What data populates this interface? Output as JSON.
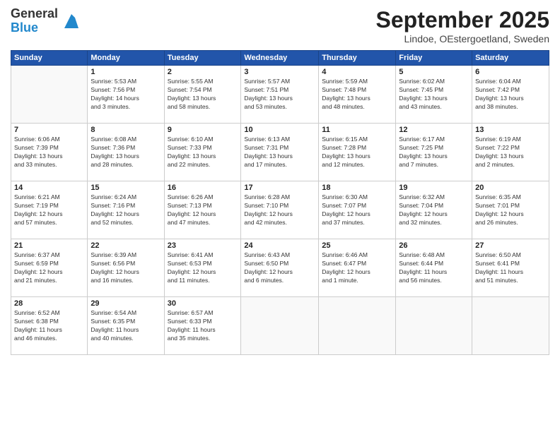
{
  "header": {
    "logo_line1": "General",
    "logo_line2": "Blue",
    "title": "September 2025",
    "location": "Lindoe, OEstergoetland, Sweden"
  },
  "days_of_week": [
    "Sunday",
    "Monday",
    "Tuesday",
    "Wednesday",
    "Thursday",
    "Friday",
    "Saturday"
  ],
  "weeks": [
    [
      {
        "day": "",
        "info": ""
      },
      {
        "day": "1",
        "info": "Sunrise: 5:53 AM\nSunset: 7:56 PM\nDaylight: 14 hours\nand 3 minutes."
      },
      {
        "day": "2",
        "info": "Sunrise: 5:55 AM\nSunset: 7:54 PM\nDaylight: 13 hours\nand 58 minutes."
      },
      {
        "day": "3",
        "info": "Sunrise: 5:57 AM\nSunset: 7:51 PM\nDaylight: 13 hours\nand 53 minutes."
      },
      {
        "day": "4",
        "info": "Sunrise: 5:59 AM\nSunset: 7:48 PM\nDaylight: 13 hours\nand 48 minutes."
      },
      {
        "day": "5",
        "info": "Sunrise: 6:02 AM\nSunset: 7:45 PM\nDaylight: 13 hours\nand 43 minutes."
      },
      {
        "day": "6",
        "info": "Sunrise: 6:04 AM\nSunset: 7:42 PM\nDaylight: 13 hours\nand 38 minutes."
      }
    ],
    [
      {
        "day": "7",
        "info": "Sunrise: 6:06 AM\nSunset: 7:39 PM\nDaylight: 13 hours\nand 33 minutes."
      },
      {
        "day": "8",
        "info": "Sunrise: 6:08 AM\nSunset: 7:36 PM\nDaylight: 13 hours\nand 28 minutes."
      },
      {
        "day": "9",
        "info": "Sunrise: 6:10 AM\nSunset: 7:33 PM\nDaylight: 13 hours\nand 22 minutes."
      },
      {
        "day": "10",
        "info": "Sunrise: 6:13 AM\nSunset: 7:31 PM\nDaylight: 13 hours\nand 17 minutes."
      },
      {
        "day": "11",
        "info": "Sunrise: 6:15 AM\nSunset: 7:28 PM\nDaylight: 13 hours\nand 12 minutes."
      },
      {
        "day": "12",
        "info": "Sunrise: 6:17 AM\nSunset: 7:25 PM\nDaylight: 13 hours\nand 7 minutes."
      },
      {
        "day": "13",
        "info": "Sunrise: 6:19 AM\nSunset: 7:22 PM\nDaylight: 13 hours\nand 2 minutes."
      }
    ],
    [
      {
        "day": "14",
        "info": "Sunrise: 6:21 AM\nSunset: 7:19 PM\nDaylight: 12 hours\nand 57 minutes."
      },
      {
        "day": "15",
        "info": "Sunrise: 6:24 AM\nSunset: 7:16 PM\nDaylight: 12 hours\nand 52 minutes."
      },
      {
        "day": "16",
        "info": "Sunrise: 6:26 AM\nSunset: 7:13 PM\nDaylight: 12 hours\nand 47 minutes."
      },
      {
        "day": "17",
        "info": "Sunrise: 6:28 AM\nSunset: 7:10 PM\nDaylight: 12 hours\nand 42 minutes."
      },
      {
        "day": "18",
        "info": "Sunrise: 6:30 AM\nSunset: 7:07 PM\nDaylight: 12 hours\nand 37 minutes."
      },
      {
        "day": "19",
        "info": "Sunrise: 6:32 AM\nSunset: 7:04 PM\nDaylight: 12 hours\nand 32 minutes."
      },
      {
        "day": "20",
        "info": "Sunrise: 6:35 AM\nSunset: 7:01 PM\nDaylight: 12 hours\nand 26 minutes."
      }
    ],
    [
      {
        "day": "21",
        "info": "Sunrise: 6:37 AM\nSunset: 6:59 PM\nDaylight: 12 hours\nand 21 minutes."
      },
      {
        "day": "22",
        "info": "Sunrise: 6:39 AM\nSunset: 6:56 PM\nDaylight: 12 hours\nand 16 minutes."
      },
      {
        "day": "23",
        "info": "Sunrise: 6:41 AM\nSunset: 6:53 PM\nDaylight: 12 hours\nand 11 minutes."
      },
      {
        "day": "24",
        "info": "Sunrise: 6:43 AM\nSunset: 6:50 PM\nDaylight: 12 hours\nand 6 minutes."
      },
      {
        "day": "25",
        "info": "Sunrise: 6:46 AM\nSunset: 6:47 PM\nDaylight: 12 hours\nand 1 minute."
      },
      {
        "day": "26",
        "info": "Sunrise: 6:48 AM\nSunset: 6:44 PM\nDaylight: 11 hours\nand 56 minutes."
      },
      {
        "day": "27",
        "info": "Sunrise: 6:50 AM\nSunset: 6:41 PM\nDaylight: 11 hours\nand 51 minutes."
      }
    ],
    [
      {
        "day": "28",
        "info": "Sunrise: 6:52 AM\nSunset: 6:38 PM\nDaylight: 11 hours\nand 46 minutes."
      },
      {
        "day": "29",
        "info": "Sunrise: 6:54 AM\nSunset: 6:35 PM\nDaylight: 11 hours\nand 40 minutes."
      },
      {
        "day": "30",
        "info": "Sunrise: 6:57 AM\nSunset: 6:33 PM\nDaylight: 11 hours\nand 35 minutes."
      },
      {
        "day": "",
        "info": ""
      },
      {
        "day": "",
        "info": ""
      },
      {
        "day": "",
        "info": ""
      },
      {
        "day": "",
        "info": ""
      }
    ]
  ]
}
